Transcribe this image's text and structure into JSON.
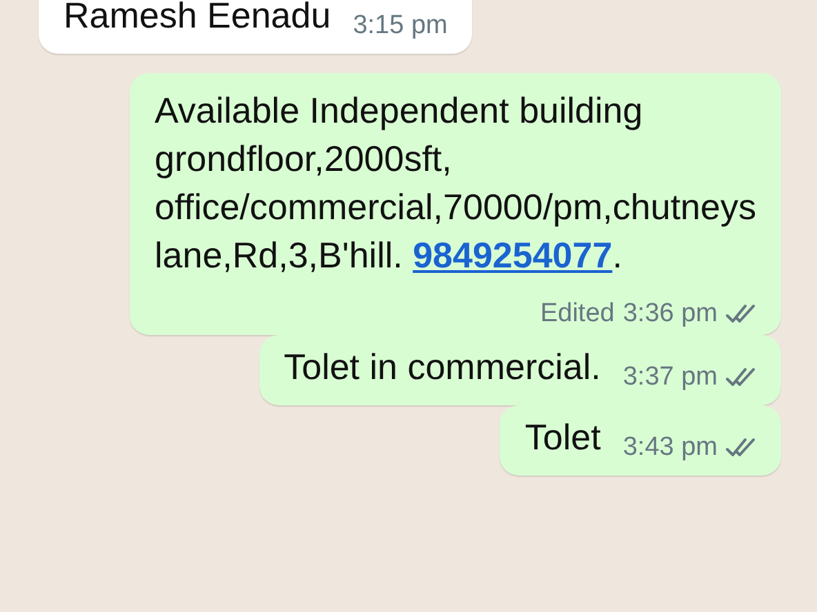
{
  "messages": [
    {
      "outgoing": false,
      "text": "Ramesh Eenadu",
      "time": "3:15 pm"
    },
    {
      "outgoing": true,
      "text": "Available Independent building grondfloor,2000sft, office/commercial,70000/pm,chutneys lane,Rd,3,B'hill.",
      "link": "9849254077",
      "after_link": ".",
      "edited": "Edited",
      "time": "3:36 pm",
      "read": false
    },
    {
      "outgoing": true,
      "text": "Tolet in commercial.",
      "time": "3:37 pm",
      "read": false
    },
    {
      "outgoing": true,
      "text": "Tolet",
      "time": "3:43 pm",
      "read": false
    }
  ]
}
